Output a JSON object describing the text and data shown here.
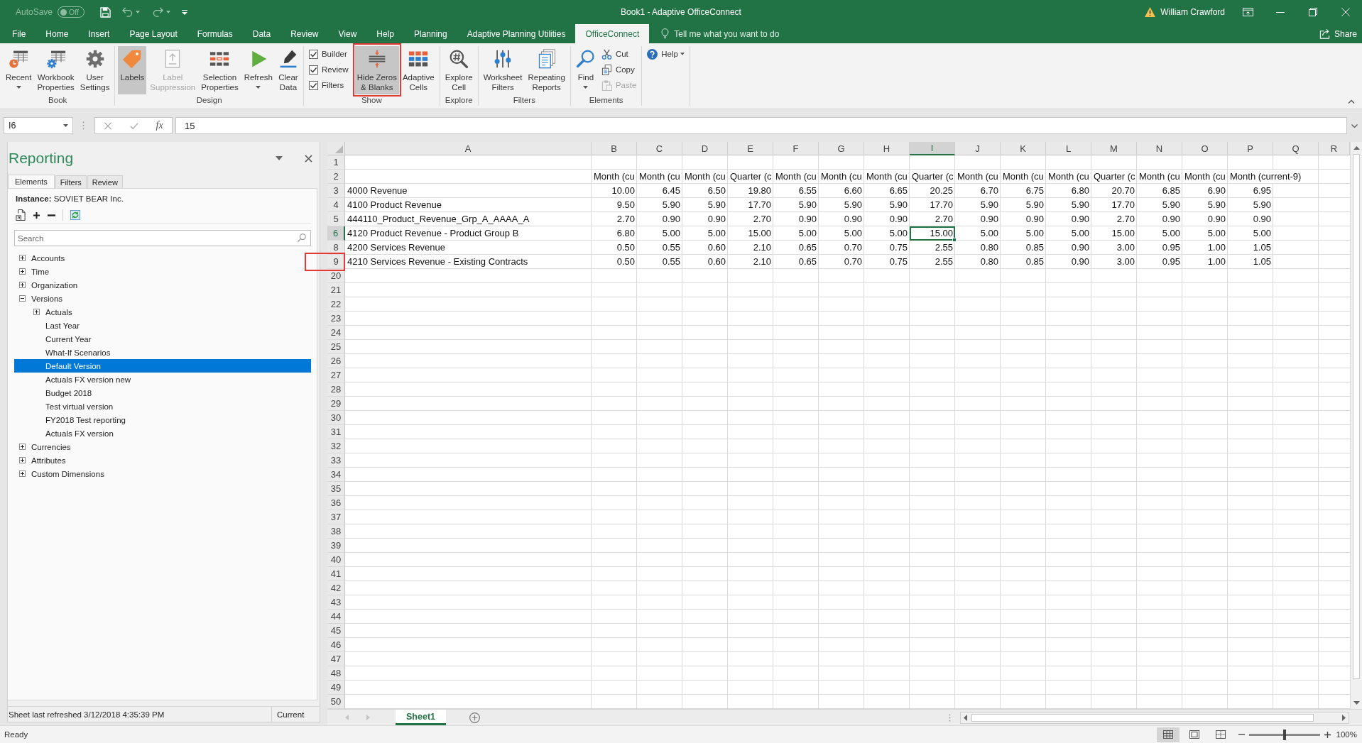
{
  "title_bar": {
    "autosave": {
      "label": "AutoSave",
      "state": "Off",
      "on": false
    },
    "title": "Book1 - Adaptive OfficeConnect",
    "user": "William Crawford"
  },
  "ribbon": {
    "tabs": [
      {
        "label": "File",
        "selected": false
      },
      {
        "label": "Home",
        "selected": false
      },
      {
        "label": "Insert",
        "selected": false
      },
      {
        "label": "Page Layout",
        "selected": false
      },
      {
        "label": "Formulas",
        "selected": false
      },
      {
        "label": "Data",
        "selected": false
      },
      {
        "label": "Review",
        "selected": false
      },
      {
        "label": "View",
        "selected": false
      },
      {
        "label": "Help",
        "selected": false
      },
      {
        "label": "Planning",
        "selected": false
      },
      {
        "label": "Adaptive Planning Utilities",
        "selected": false
      },
      {
        "label": "OfficeConnect",
        "selected": true
      }
    ],
    "tell_me": {
      "placeholder": "Tell me what you want to do"
    },
    "share": "Share",
    "groups": [
      {
        "label": "Book",
        "items": [
          {
            "kind": "large",
            "label": "Recent",
            "dropdown": true,
            "pressed": false,
            "disabled": false,
            "marked": false
          },
          {
            "kind": "large",
            "label": "Workbook\nProperties",
            "dropdown": false,
            "pressed": false,
            "disabled": false,
            "marked": false
          },
          {
            "kind": "large",
            "label": "User\nSettings",
            "dropdown": false,
            "pressed": false,
            "disabled": false,
            "marked": false
          }
        ]
      },
      {
        "label": "Design",
        "items": [
          {
            "kind": "large",
            "label": "Labels",
            "dropdown": false,
            "pressed": true,
            "disabled": false,
            "marked": false
          },
          {
            "kind": "large",
            "label": "Label\nSuppression",
            "dropdown": false,
            "pressed": false,
            "disabled": true,
            "marked": false
          },
          {
            "kind": "large",
            "label": "Selection\nProperties",
            "dropdown": false,
            "pressed": false,
            "disabled": false,
            "marked": false
          },
          {
            "kind": "large",
            "label": "Refresh",
            "dropdown": true,
            "pressed": false,
            "disabled": false,
            "marked": false
          },
          {
            "kind": "large",
            "label": "Clear\nData",
            "dropdown": false,
            "pressed": false,
            "disabled": false,
            "marked": false
          }
        ]
      },
      {
        "label": "Show",
        "items": [
          {
            "kind": "checks",
            "checks": [
              {
                "label": "Builder",
                "checked": true
              },
              {
                "label": "Review",
                "checked": true
              },
              {
                "label": "Filters",
                "checked": true
              }
            ]
          },
          {
            "kind": "large",
            "label": "Hide Zeros\n& Blanks",
            "dropdown": false,
            "pressed": true,
            "disabled": false,
            "marked": true
          },
          {
            "kind": "large",
            "label": "Adaptive\nCells",
            "dropdown": false,
            "pressed": false,
            "disabled": false,
            "marked": false
          }
        ]
      },
      {
        "label": "Explore",
        "items": [
          {
            "kind": "large",
            "label": "Explore\nCell",
            "dropdown": false,
            "pressed": false,
            "disabled": false,
            "marked": false
          }
        ]
      },
      {
        "label": "Filters",
        "items": [
          {
            "kind": "large",
            "label": "Worksheet\nFilters",
            "dropdown": false,
            "pressed": false,
            "disabled": false,
            "marked": false
          },
          {
            "kind": "large",
            "label": "Repeating\nReports",
            "dropdown": false,
            "pressed": false,
            "disabled": false,
            "marked": false
          }
        ]
      },
      {
        "label": "Elements",
        "items": [
          {
            "kind": "large",
            "label": "Find",
            "dropdown": true,
            "pressed": false,
            "disabled": false,
            "marked": false
          },
          {
            "kind": "small_stack",
            "buttons": [
              {
                "label": "Cut",
                "disabled": false
              },
              {
                "label": "Copy",
                "disabled": false
              },
              {
                "label": "Paste",
                "disabled": true
              }
            ]
          }
        ]
      },
      {
        "items": [
          {
            "kind": "small",
            "label": "Help",
            "dropdown": true,
            "disabled": false
          }
        ]
      }
    ]
  },
  "formula_bar": {
    "name_box": "I6",
    "function_label": "fx",
    "value": "15"
  },
  "panel": {
    "title": "Reporting",
    "tabs": [
      {
        "label": "Elements",
        "selected": true
      },
      {
        "label": "Filters",
        "selected": false
      },
      {
        "label": "Review",
        "selected": false
      }
    ],
    "instance": "**Instance:** SOVIET BEAR Inc.",
    "search": {
      "placeholder": "Search"
    },
    "tree": [
      {
        "label": "Accounts",
        "expanded": false,
        "selected": false
      },
      {
        "label": "Time",
        "expanded": false,
        "selected": false
      },
      {
        "label": "Organization",
        "expanded": false,
        "selected": false
      },
      {
        "label": "Versions",
        "expanded": true,
        "selected": false,
        "children": [
          {
            "label": "Actuals",
            "expanded": false,
            "selected": false
          },
          {
            "label": "Last Year",
            "selected": false
          },
          {
            "label": "Current Year",
            "selected": false
          },
          {
            "label": "What-If Scenarios",
            "selected": false
          },
          {
            "label": "Default Version",
            "selected": true
          },
          {
            "label": "Actuals FX version new",
            "selected": false
          },
          {
            "label": "Budget 2018",
            "selected": false
          },
          {
            "label": "Test virtual version",
            "selected": false
          },
          {
            "label": "FY2018 Test reporting",
            "selected": false
          },
          {
            "label": "Actuals FX version",
            "selected": false
          }
        ]
      },
      {
        "label": "Currencies",
        "expanded": false,
        "selected": false
      },
      {
        "label": "Attributes",
        "expanded": false,
        "selected": false
      },
      {
        "label": "Custom Dimensions",
        "expanded": false,
        "selected": false
      }
    ],
    "status": {
      "text": "Sheet last refreshed 3/12/2018 4:35:39 PM",
      "version": "Current"
    }
  },
  "sheet": {
    "columns": [
      {
        "label": "A",
        "selected": false
      },
      {
        "label": "B",
        "selected": false
      },
      {
        "label": "C",
        "selected": false
      },
      {
        "label": "D",
        "selected": false
      },
      {
        "label": "E",
        "selected": false
      },
      {
        "label": "F",
        "selected": false
      },
      {
        "label": "G",
        "selected": false
      },
      {
        "label": "H",
        "selected": false
      },
      {
        "label": "I",
        "selected": true
      },
      {
        "label": "J",
        "selected": false
      },
      {
        "label": "K",
        "selected": false
      },
      {
        "label": "L",
        "selected": false
      },
      {
        "label": "M",
        "selected": false
      },
      {
        "label": "N",
        "selected": false
      },
      {
        "label": "O",
        "selected": false
      },
      {
        "label": "P",
        "selected": false
      },
      {
        "label": "Q",
        "selected": false
      },
      {
        "label": "R",
        "selected": false
      }
    ],
    "rows": [
      {
        "number": "1",
        "selected": false,
        "marked": false,
        "kind": "blank"
      },
      {
        "number": "2",
        "selected": false,
        "marked": false,
        "kind": "header",
        "values": [
          "Month (cu",
          "Month (cu",
          "Month (cu",
          "Quarter (c",
          "Month (cu",
          "Month (cu",
          "Month (cu",
          "Quarter (c",
          "Month (cu",
          "Month (cu",
          "Month (cu",
          "Quarter (c",
          "Month (cu",
          "Month (cu",
          "Month (current-9)"
        ]
      },
      {
        "number": "3",
        "selected": false,
        "marked": false,
        "kind": "data",
        "label": "4000 Revenue",
        "values": [
          "10.00",
          "6.45",
          "6.50",
          "19.80",
          "6.55",
          "6.60",
          "6.65",
          "20.25",
          "6.70",
          "6.75",
          "6.80",
          "20.70",
          "6.85",
          "6.90",
          "6.95"
        ]
      },
      {
        "number": "4",
        "selected": false,
        "marked": false,
        "kind": "data",
        "label": "4100 Product Revenue",
        "values": [
          "9.50",
          "5.90",
          "5.90",
          "17.70",
          "5.90",
          "5.90",
          "5.90",
          "17.70",
          "5.90",
          "5.90",
          "5.90",
          "17.70",
          "5.90",
          "5.90",
          "5.90"
        ]
      },
      {
        "number": "5",
        "selected": false,
        "marked": false,
        "kind": "data",
        "label": "444110_Product_Revenue_Grp_A_AAAA_A",
        "values": [
          "2.70",
          "0.90",
          "0.90",
          "2.70",
          "0.90",
          "0.90",
          "0.90",
          "2.70",
          "0.90",
          "0.90",
          "0.90",
          "2.70",
          "0.90",
          "0.90",
          "0.90"
        ]
      },
      {
        "number": "6",
        "selected": true,
        "marked": false,
        "kind": "data",
        "label": "4120 Product Revenue - Product Group B",
        "values": [
          "6.80",
          "5.00",
          "5.00",
          "15.00",
          "5.00",
          "5.00",
          "5.00",
          "15.00",
          "5.00",
          "5.00",
          "5.00",
          "15.00",
          "5.00",
          "5.00",
          "5.00"
        ]
      },
      {
        "number": "8",
        "selected": false,
        "marked": false,
        "kind": "data",
        "label": "4200 Services Revenue",
        "values": [
          "0.50",
          "0.55",
          "0.60",
          "2.10",
          "0.65",
          "0.70",
          "0.75",
          "2.55",
          "0.80",
          "0.85",
          "0.90",
          "3.00",
          "0.95",
          "1.00",
          "1.05"
        ]
      },
      {
        "number": "9",
        "selected": false,
        "marked": true,
        "kind": "data",
        "label": "4210 Services Revenue - Existing Contracts",
        "values": [
          "0.50",
          "0.55",
          "0.60",
          "2.10",
          "0.65",
          "0.70",
          "0.75",
          "2.55",
          "0.80",
          "0.85",
          "0.90",
          "3.00",
          "0.95",
          "1.00",
          "1.05"
        ]
      },
      {
        "number": "20",
        "selected": false,
        "marked": false,
        "kind": "blank"
      },
      {
        "number": "21",
        "selected": false,
        "marked": false,
        "kind": "blank"
      },
      {
        "number": "22",
        "selected": false,
        "marked": false,
        "kind": "blank"
      },
      {
        "number": "23",
        "selected": false,
        "marked": false,
        "kind": "blank"
      },
      {
        "number": "24",
        "selected": false,
        "marked": false,
        "kind": "blank"
      },
      {
        "number": "25",
        "selected": false,
        "marked": false,
        "kind": "blank"
      },
      {
        "number": "26",
        "selected": false,
        "marked": false,
        "kind": "blank"
      },
      {
        "number": "27",
        "selected": false,
        "marked": false,
        "kind": "blank"
      },
      {
        "number": "28",
        "selected": false,
        "marked": false,
        "kind": "blank"
      },
      {
        "number": "29",
        "selected": false,
        "marked": false,
        "kind": "blank"
      },
      {
        "number": "30",
        "selected": false,
        "marked": false,
        "kind": "blank"
      },
      {
        "number": "31",
        "selected": false,
        "marked": false,
        "kind": "blank"
      },
      {
        "number": "32",
        "selected": false,
        "marked": false,
        "kind": "blank"
      },
      {
        "number": "33",
        "selected": false,
        "marked": false,
        "kind": "blank"
      },
      {
        "number": "34",
        "selected": false,
        "marked": false,
        "kind": "blank"
      },
      {
        "number": "35",
        "selected": false,
        "marked": false,
        "kind": "blank"
      },
      {
        "number": "36",
        "selected": false,
        "marked": false,
        "kind": "blank"
      },
      {
        "number": "37",
        "selected": false,
        "marked": false,
        "kind": "blank"
      },
      {
        "number": "38",
        "selected": false,
        "marked": false,
        "kind": "blank"
      },
      {
        "number": "39",
        "selected": false,
        "marked": false,
        "kind": "blank"
      },
      {
        "number": "40",
        "selected": false,
        "marked": false,
        "kind": "blank"
      },
      {
        "number": "41",
        "selected": false,
        "marked": false,
        "kind": "blank"
      },
      {
        "number": "42",
        "selected": false,
        "marked": false,
        "kind": "blank"
      },
      {
        "number": "43",
        "selected": false,
        "marked": false,
        "kind": "blank"
      },
      {
        "number": "44",
        "selected": false,
        "marked": false,
        "kind": "blank"
      },
      {
        "number": "45",
        "selected": false,
        "marked": false,
        "kind": "blank"
      },
      {
        "number": "46",
        "selected": false,
        "marked": false,
        "kind": "blank"
      },
      {
        "number": "47",
        "selected": false,
        "marked": false,
        "kind": "blank"
      },
      {
        "number": "48",
        "selected": false,
        "marked": false,
        "kind": "blank"
      },
      {
        "number": "49",
        "selected": false,
        "marked": false,
        "kind": "blank"
      },
      {
        "number": "50",
        "selected": false,
        "marked": false,
        "kind": "blank"
      }
    ]
  },
  "sheet_tabs": [
    {
      "label": "Sheet1",
      "selected": true
    }
  ],
  "status_bar": {
    "text": "Ready",
    "views": [
      {
        "selected": true
      },
      {
        "selected": false
      },
      {
        "selected": false
      }
    ],
    "zoom": {
      "level": 0.5,
      "reading": "100%"
    }
  }
}
